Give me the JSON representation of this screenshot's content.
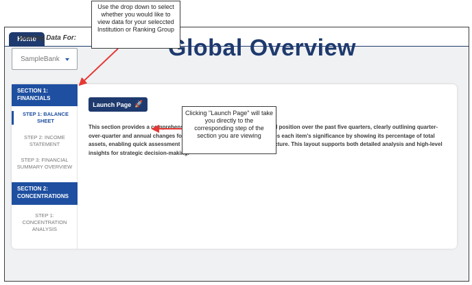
{
  "tabs": [
    {
      "label": "Home"
    }
  ],
  "viewing": {
    "label": "Viewing Data For:",
    "selected": "SampleBank"
  },
  "page": {
    "title": "Global Overview"
  },
  "sidebar": {
    "sections": [
      {
        "label": "SECTION 1: FINANCIALS",
        "steps": [
          "STEP 1: BALANCE SHEET",
          "STEP 2: INCOME STATEMENT",
          "STEP 3: FINANCIAL SUMMARY OVERVIEW"
        ]
      },
      {
        "label": "SECTION 2: CONCENTRATIONS",
        "steps": [
          "STEP 1: CONCENTRATION ANALYSIS"
        ]
      }
    ]
  },
  "main": {
    "launch_label": "Launch Page",
    "description": "This section provides a comprehensive view of the institution's financial position over the past five quarters, clearly outlining quarter-over-quarter and annual changes for each line item. It also contextualizes each item's significance by showing its percentage of total assets, enabling quick assessment of trends and shifts in financial structure. This layout supports both detailed analysis and high-level insights for strategic decision-making."
  },
  "callouts": {
    "dropdown": "Use the drop down to select whether you would like to view data for your seleccted Institution or Ranking Group",
    "launch": "Clicking \"Launch Page\" will take you directly to the corresponding step of the section you are viewing"
  },
  "colors": {
    "primary": "#1e3a6e",
    "accent": "#1e4fa0",
    "arrow": "#e53935"
  },
  "icons": {
    "launch": "rocket-icon",
    "dropdown": "caret-down-icon"
  }
}
